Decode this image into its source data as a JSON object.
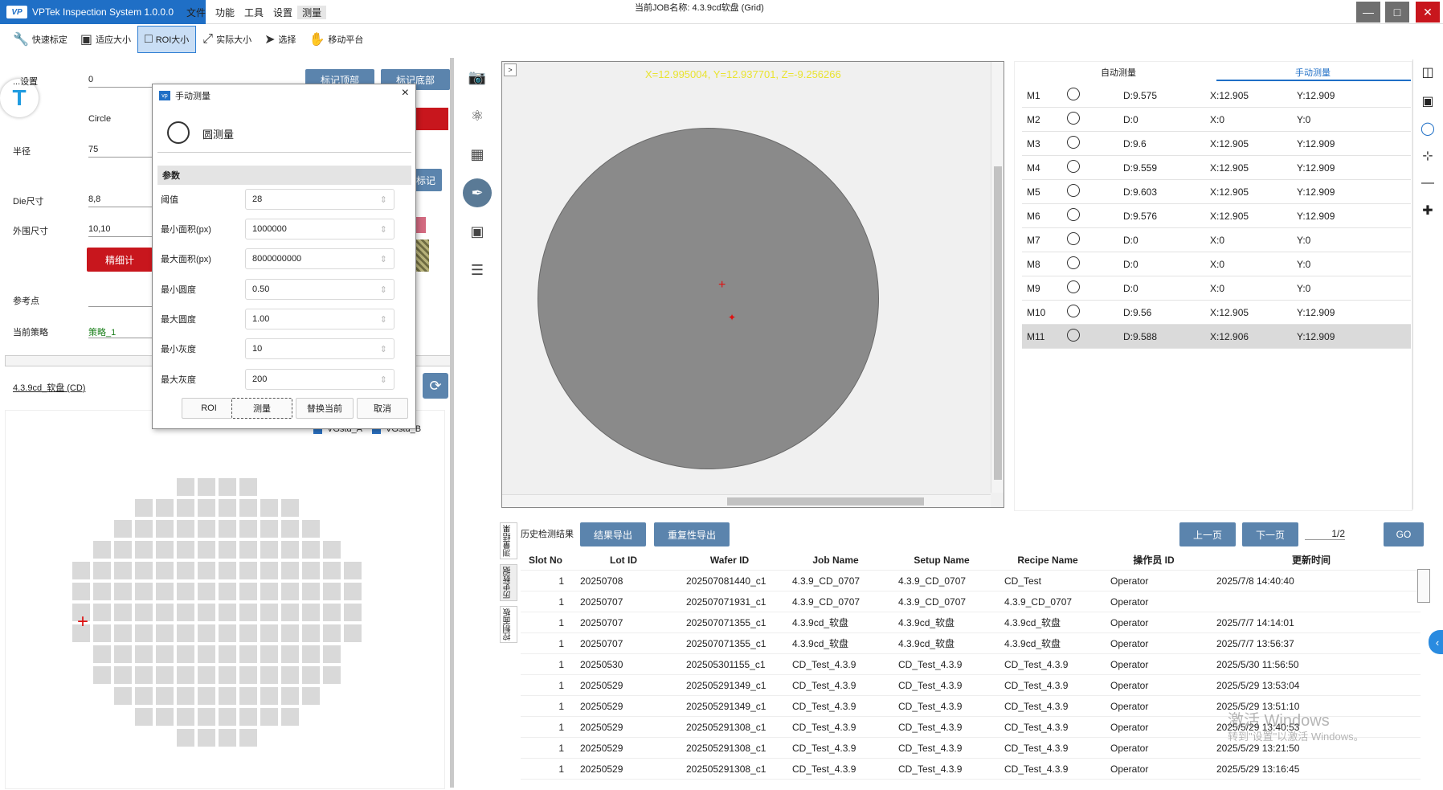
{
  "app": {
    "title": "VPTek Inspection System 1.0.0.0",
    "menu": [
      "文件",
      "功能",
      "工具",
      "设置",
      "测量"
    ],
    "job_label": "当前JOB名称:",
    "job_name": "4.3.9cd软盘 (Grid)",
    "brand_color": "#1f6fc6"
  },
  "toolbar": [
    {
      "label": "快速标定",
      "icon": "wrench-icon"
    },
    {
      "label": "适应大小",
      "icon": "fit-icon"
    },
    {
      "label": "ROI大小",
      "icon": "roi-icon",
      "active": true
    },
    {
      "label": "实际大小",
      "icon": "expand-icon"
    },
    {
      "label": "选择",
      "icon": "cursor-icon"
    },
    {
      "label": "移动平台",
      "icon": "hand-icon"
    }
  ],
  "left": {
    "fields": [
      {
        "label": "...设置",
        "value": "0"
      },
      {
        "label": "",
        "value": "Circle"
      },
      {
        "label": "半径",
        "value": "75"
      },
      {
        "label": "Die尺寸",
        "value": "8,8"
      },
      {
        "label": "外围尺寸",
        "value": "10,10"
      },
      {
        "label": "参考点",
        "value": ""
      },
      {
        "label": "当前策略",
        "value": "策略_1"
      }
    ],
    "btn_mark_top": "标记顶部",
    "btn_mark_bottom": "标记底部",
    "btn_mark": "标记",
    "btn_fine": "精细计",
    "recipe_link": "4.3.9cd_软盘 (CD)",
    "vg_a": "VGstd_A",
    "vg_b": "VGstd_B"
  },
  "dialog": {
    "title": "手动测量",
    "mode": "圆测量",
    "section": "参数",
    "params": [
      {
        "label": "阈值",
        "value": "28"
      },
      {
        "label": "最小面积(px)",
        "value": "1000000"
      },
      {
        "label": "最大面积(px)",
        "value": "8000000000"
      },
      {
        "label": "最小圆度",
        "value": "0.50"
      },
      {
        "label": "最大圆度",
        "value": "1.00"
      },
      {
        "label": "最小灰度",
        "value": "10"
      },
      {
        "label": "最大灰度",
        "value": "200"
      }
    ],
    "buttons": [
      "ROI",
      "测量",
      "替换当前",
      "取消"
    ]
  },
  "image": {
    "coord": "X=12.995004, Y=12.937701, Z=-9.256266"
  },
  "right": {
    "tabs": [
      "自动测量",
      "手动测量"
    ],
    "active_tab": 1,
    "rows": [
      {
        "id": "M1",
        "d": "D:9.575",
        "x": "X:12.905",
        "y": "Y:12.909"
      },
      {
        "id": "M2",
        "d": "D:0",
        "x": "X:0",
        "y": "Y:0"
      },
      {
        "id": "M3",
        "d": "D:9.6",
        "x": "X:12.905",
        "y": "Y:12.909"
      },
      {
        "id": "M4",
        "d": "D:9.559",
        "x": "X:12.905",
        "y": "Y:12.909"
      },
      {
        "id": "M5",
        "d": "D:9.603",
        "x": "X:12.905",
        "y": "Y:12.909"
      },
      {
        "id": "M6",
        "d": "D:9.576",
        "x": "X:12.905",
        "y": "Y:12.909"
      },
      {
        "id": "M7",
        "d": "D:0",
        "x": "X:0",
        "y": "Y:0"
      },
      {
        "id": "M8",
        "d": "D:0",
        "x": "X:0",
        "y": "Y:0"
      },
      {
        "id": "M9",
        "d": "D:0",
        "x": "X:0",
        "y": "Y:0"
      },
      {
        "id": "M10",
        "d": "D:9.56",
        "x": "X:12.905",
        "y": "Y:12.909"
      },
      {
        "id": "M11",
        "d": "D:9.588",
        "x": "X:12.906",
        "y": "Y:12.909"
      }
    ]
  },
  "history": {
    "side_tabs": [
      "测量结果",
      "历史数据",
      "控制面板"
    ],
    "title": "历史检测结果",
    "btn_export": "结果导出",
    "btn_repeat": "重复性导出",
    "btn_prev": "上一页",
    "btn_next": "下一页",
    "page": "1/2",
    "btn_go": "GO",
    "columns": [
      "Slot No",
      "Lot ID",
      "Wafer ID",
      "Job Name",
      "Setup Name",
      "Recipe Name",
      "操作员 ID",
      "更新时间"
    ],
    "rows": [
      [
        "1",
        "20250708",
        "202507081440_c1",
        "4.3.9_CD_0707",
        "4.3.9_CD_0707",
        "CD_Test",
        "Operator",
        "2025/7/8 14:40:40"
      ],
      [
        "1",
        "20250707",
        "202507071931_c1",
        "4.3.9_CD_0707",
        "4.3.9_CD_0707",
        "4.3.9_CD_0707",
        "Operator",
        ""
      ],
      [
        "1",
        "20250707",
        "202507071355_c1",
        "4.3.9cd_软盘",
        "4.3.9cd_软盘",
        "4.3.9cd_软盘",
        "Operator",
        "2025/7/7 14:14:01"
      ],
      [
        "1",
        "20250707",
        "202507071355_c1",
        "4.3.9cd_软盘",
        "4.3.9cd_软盘",
        "4.3.9cd_软盘",
        "Operator",
        "2025/7/7 13:56:37"
      ],
      [
        "1",
        "20250530",
        "202505301155_c1",
        "CD_Test_4.3.9",
        "CD_Test_4.3.9",
        "CD_Test_4.3.9",
        "Operator",
        "2025/5/30 11:56:50"
      ],
      [
        "1",
        "20250529",
        "202505291349_c1",
        "CD_Test_4.3.9",
        "CD_Test_4.3.9",
        "CD_Test_4.3.9",
        "Operator",
        "2025/5/29 13:53:04"
      ],
      [
        "1",
        "20250529",
        "202505291349_c1",
        "CD_Test_4.3.9",
        "CD_Test_4.3.9",
        "CD_Test_4.3.9",
        "Operator",
        "2025/5/29 13:51:10"
      ],
      [
        "1",
        "20250529",
        "202505291308_c1",
        "CD_Test_4.3.9",
        "CD_Test_4.3.9",
        "CD_Test_4.3.9",
        "Operator",
        "2025/5/29 13:40:53"
      ],
      [
        "1",
        "20250529",
        "202505291308_c1",
        "CD_Test_4.3.9",
        "CD_Test_4.3.9",
        "CD_Test_4.3.9",
        "Operator",
        "2025/5/29 13:21:50"
      ],
      [
        "1",
        "20250529",
        "202505291308_c1",
        "CD_Test_4.3.9",
        "CD_Test_4.3.9",
        "CD_Test_4.3.9",
        "Operator",
        "2025/5/29 13:16:45"
      ]
    ]
  },
  "watermark": {
    "line1": "激活 Windows",
    "line2": "转到\"设置\"以激活 Windows。"
  }
}
